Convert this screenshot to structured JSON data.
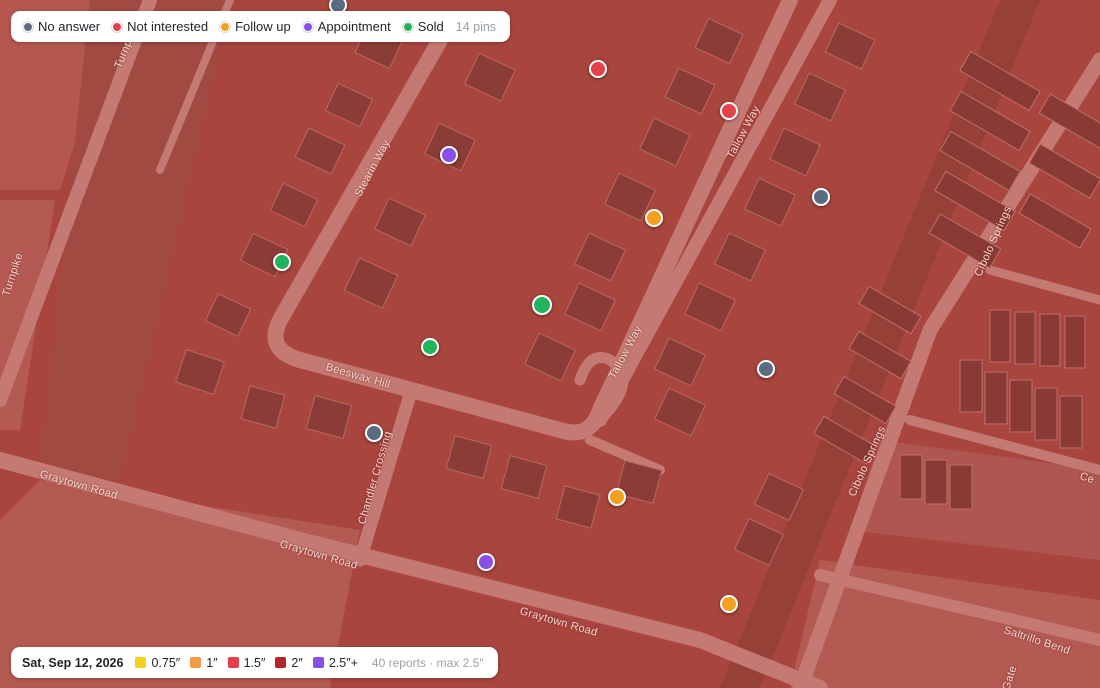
{
  "legend": {
    "statuses": [
      {
        "key": "no_answer",
        "label": "No answer",
        "color": "#5a6b82"
      },
      {
        "key": "not_interested",
        "label": "Not interested",
        "color": "#e5414a"
      },
      {
        "key": "follow_up",
        "label": "Follow up",
        "color": "#f2a01d"
      },
      {
        "key": "appointment",
        "label": "Appointment",
        "color": "#8a4fe8"
      },
      {
        "key": "sold",
        "label": "Sold",
        "color": "#22b35c"
      }
    ],
    "pin_count": "14 pins"
  },
  "hail": {
    "date": "Sat, Sep 12, 2026",
    "sizes": [
      {
        "label": "0.75″",
        "color": "#f5cf1c"
      },
      {
        "label": "1″",
        "color": "#f59a45"
      },
      {
        "label": "1.5″",
        "color": "#e5414a"
      },
      {
        "label": "2″",
        "color": "#b3262b"
      },
      {
        "label": "2.5″+",
        "color": "#8a4fe8"
      }
    ],
    "summary": "40 reports · max 2.5″"
  },
  "streets": [
    {
      "name": "Turnpike"
    },
    {
      "name": "Turnpike"
    },
    {
      "name": "Stearin Way"
    },
    {
      "name": "Tallow Way"
    },
    {
      "name": "Tallow Way"
    },
    {
      "name": "Beeswax Hill"
    },
    {
      "name": "Chandler Crossing"
    },
    {
      "name": "Graytown Road"
    },
    {
      "name": "Graytown Road"
    },
    {
      "name": "Graytown Road"
    },
    {
      "name": "Cibolo Springs"
    },
    {
      "name": "Cibolo Springs"
    },
    {
      "name": "Saltrillo Bend"
    },
    {
      "name": "Ce"
    },
    {
      "name": "Gate"
    }
  ],
  "pins": [
    {
      "status": "no_answer"
    },
    {
      "status": "not_interested"
    },
    {
      "status": "not_interested"
    },
    {
      "status": "appointment"
    },
    {
      "status": "no_answer"
    },
    {
      "status": "follow_up"
    },
    {
      "status": "sold"
    },
    {
      "status": "sold"
    },
    {
      "status": "sold"
    },
    {
      "status": "no_answer"
    },
    {
      "status": "no_answer"
    },
    {
      "status": "follow_up"
    },
    {
      "status": "appointment"
    },
    {
      "status": "follow_up"
    }
  ]
}
